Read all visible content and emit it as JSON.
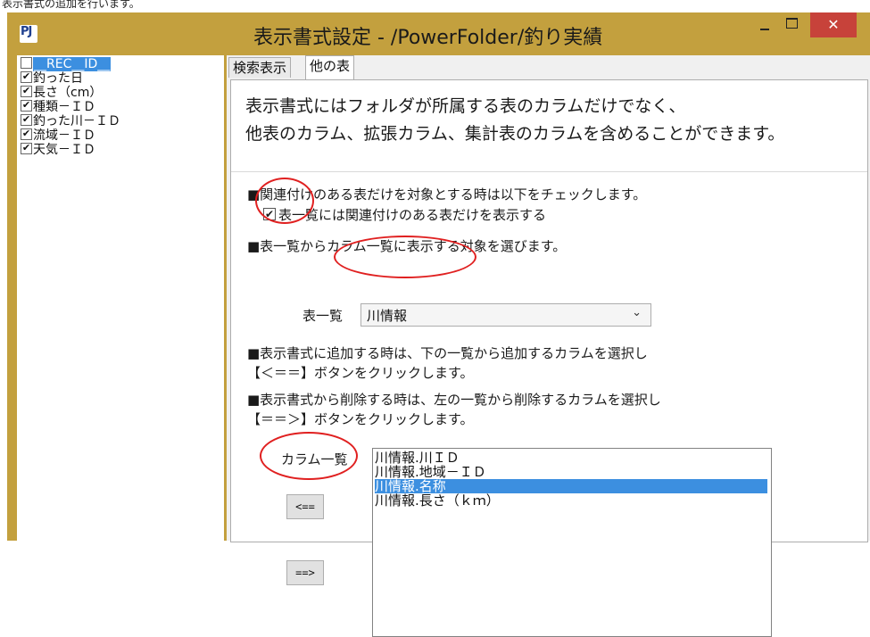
{
  "window": {
    "title": "表示書式設定 - /PowerFolder/釣り実績",
    "app_icon": "PJ",
    "close_label": "✕",
    "top_caption": "表示書式の追加を行います。"
  },
  "left_list": {
    "items": [
      {
        "label": "__REC__ID__",
        "checked": false,
        "highlighted": true
      },
      {
        "label": "釣った日",
        "checked": true,
        "highlighted": false
      },
      {
        "label": "長さ（cm）",
        "checked": true,
        "highlighted": false
      },
      {
        "label": "種類－ＩＤ",
        "checked": true,
        "highlighted": false
      },
      {
        "label": "釣った川－ＩＤ",
        "checked": true,
        "highlighted": false
      },
      {
        "label": "流域－ＩＤ",
        "checked": true,
        "highlighted": false
      },
      {
        "label": "天気－ＩＤ",
        "checked": true,
        "highlighted": false
      }
    ]
  },
  "tabs": [
    {
      "label": "検索表示",
      "active": false
    },
    {
      "label": "他の表",
      "active": true
    }
  ],
  "content": {
    "intro_line1": "表示書式にはフォルダが所属する表のカラムだけでなく、",
    "intro_line2": "他表のカラム、拡張カラム、集計表のカラムを含めることができます。",
    "sec1": "■関連付けのある表だけを対象とする時は以下をチェックします。",
    "check_label": "表一覧には関連付けのある表だけを表示する",
    "check_checked": true,
    "sec2": "■表一覧からカラム一覧に表示する対象を選びます。",
    "table_label": "表一覧",
    "table_value": "川情報",
    "chevron_icon": "chevron-down-icon",
    "sec3a": "■表示書式に追加する時は、下の一覧から追加するカラムを選択し",
    "sec3b": "【＜＝＝】ボタンをクリックします。",
    "sec4a": "■表示書式から削除する時は、左の一覧から削除するカラムを選択し",
    "sec4b": "【＝＝＞】ボタンをクリックします。",
    "column_list_label": "カラム一覧",
    "columns": [
      {
        "label": "川情報.川ＩＤ",
        "selected": false
      },
      {
        "label": "川情報.地域－ＩＤ",
        "selected": false
      },
      {
        "label": "川情報.名称",
        "selected": true
      },
      {
        "label": "川情報.長さ（ｋｍ）",
        "selected": false
      }
    ],
    "add_button": "<==",
    "remove_button": "==>"
  },
  "colors": {
    "title_bar": "#c3a03e",
    "close_button": "#c7423a",
    "selection": "#3c8fe0",
    "annotation_circle": "#e02020"
  }
}
